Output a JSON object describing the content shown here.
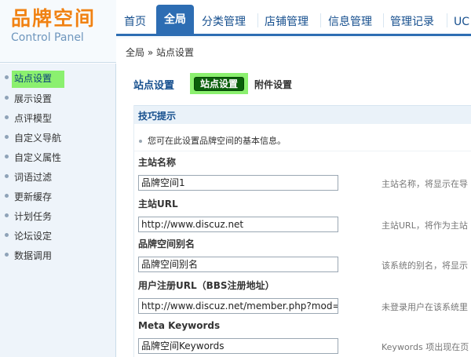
{
  "logo": {
    "title": "品牌空间",
    "subtitle": "Control Panel"
  },
  "nav": {
    "items": [
      {
        "label": "首页"
      },
      {
        "label": "全局"
      },
      {
        "label": "分类管理"
      },
      {
        "label": "店铺管理"
      },
      {
        "label": "信息管理"
      },
      {
        "label": "管理记录"
      },
      {
        "label": "UC"
      }
    ],
    "active": "全局"
  },
  "breadcrumb": "全局 » 站点设置",
  "sidebar": {
    "items": [
      {
        "label": "站点设置",
        "active": true
      },
      {
        "label": "展示设置"
      },
      {
        "label": "点评模型"
      },
      {
        "label": "自定义导航"
      },
      {
        "label": "自定义属性"
      },
      {
        "label": "词语过滤"
      },
      {
        "label": "更新缓存"
      },
      {
        "label": "计划任务"
      },
      {
        "label": "论坛设定"
      },
      {
        "label": "数据调用"
      }
    ]
  },
  "main": {
    "title": "站点设置",
    "subtabs": {
      "active": "站点设置",
      "other": "附件设置"
    },
    "tips": {
      "heading": "技巧提示",
      "text": "您可在此设置品牌空间的基本信息。"
    },
    "fields": [
      {
        "label": "主站名称",
        "value": "品牌空间1",
        "desc": "主站名称，将显示在导"
      },
      {
        "label": "主站URL",
        "value": "http://www.discuz.net",
        "desc": "主站URL，将作为主站"
      },
      {
        "label": "品牌空间别名",
        "value": "品牌空间别名",
        "desc": "该系统的别名，将显示"
      },
      {
        "label": "用户注册URL（BBS注册地址）",
        "value": "http://www.discuz.net/member.php?mod=",
        "desc": "未登录用户在该系统里"
      },
      {
        "label": "Meta Keywords",
        "value": "品牌空间Keywords",
        "desc": "Keywords 项出现在页"
      }
    ]
  },
  "colors": {
    "accent": "#2d6db3",
    "highlight": "#8bf06f",
    "logo": "#f08213"
  }
}
